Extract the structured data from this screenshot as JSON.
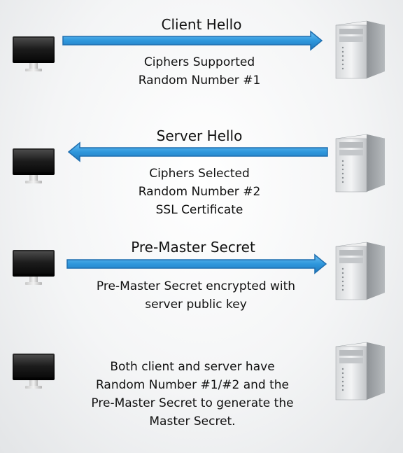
{
  "steps": [
    {
      "title": "Client Hello",
      "direction": "client-to-server",
      "lines": [
        "Ciphers Supported",
        "Random Number #1"
      ]
    },
    {
      "title": "Server Hello",
      "direction": "server-to-client",
      "lines": [
        "Ciphers Selected",
        "Random Number #2",
        "SSL Certificate"
      ]
    },
    {
      "title": "Pre-Master Secret",
      "direction": "client-to-server",
      "lines": [
        "Pre-Master Secret encrypted with",
        "server public key"
      ]
    },
    {
      "title": "",
      "direction": "none",
      "lines": [
        "Both client and server have",
        "Random Number #1/#2 and the",
        "Pre-Master Secret to generate the",
        "Master Secret."
      ]
    }
  ],
  "colors": {
    "arrow_fill": "#3aa0e2",
    "arrow_stroke": "#1f6fb0"
  }
}
